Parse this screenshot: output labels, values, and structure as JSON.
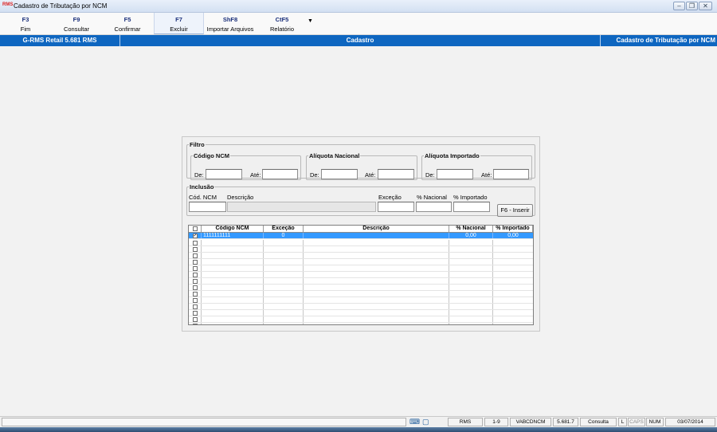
{
  "window": {
    "app_logo": "RMS",
    "title": "Cadastro de Tributação por NCM",
    "min_glyph": "–",
    "restore_glyph": "❐",
    "close_glyph": "✕"
  },
  "toolbar": {
    "buttons": [
      {
        "key": "F3",
        "label": "Fim"
      },
      {
        "key": "F9",
        "label": "Consultar"
      },
      {
        "key": "F5",
        "label": "Confirmar"
      },
      {
        "key": "F7",
        "label": "Excluir"
      },
      {
        "key": "ShF8",
        "label": "Importar Arquivos"
      },
      {
        "key": "CtF5",
        "label": "Relatório"
      }
    ],
    "more_glyph": "▼"
  },
  "header": {
    "product": "G-RMS Retail 5.681 RMS",
    "section": "Cadastro",
    "screen": "Cadastro de Tributação por NCM"
  },
  "filtro": {
    "legend": "Filtro",
    "codigo_ncm": {
      "legend": "Código NCM",
      "de_label": "De:",
      "ate_label": "Até:",
      "de_value": "",
      "ate_value": ""
    },
    "aliquota_nacional": {
      "legend": "Alíquota Nacional",
      "de_label": "De:",
      "ate_label": "Até:",
      "de_value": "",
      "ate_value": ""
    },
    "aliquota_importado": {
      "legend": "Alíquota Importado",
      "de_label": "De:",
      "ate_label": "Até:",
      "de_value": "",
      "ate_value": ""
    }
  },
  "inclusao": {
    "legend": "Inclusão",
    "labels": {
      "cod_ncm": "Cód. NCM",
      "descricao": "Descrição",
      "excecao": "Exceção",
      "nacional": "% Nacional",
      "importado": "% Importado"
    },
    "values": {
      "cod_ncm": "",
      "descricao": "",
      "excecao": "",
      "nacional": "",
      "importado": ""
    },
    "insert_button": "F6 - Inserir"
  },
  "grid": {
    "columns": [
      "Código NCM",
      "Exceção",
      "Descrição",
      "% Nacional",
      "% Importado"
    ],
    "rows": [
      {
        "checked": true,
        "codigo": "1111111111",
        "excecao": "0",
        "descricao": "",
        "nacional": "0,00",
        "importado": "0,00"
      }
    ],
    "check_glyph": "✓"
  },
  "status": {
    "icons": [
      "keyboard-icon",
      "clipboard-icon"
    ],
    "system": "RMS",
    "position": "1-9",
    "program": "VABCDNCM",
    "version": "5.681.7",
    "mode": "Consulta",
    "l": "L",
    "caps": "CAPS",
    "num": "NUM",
    "date": "03/07/2014"
  }
}
